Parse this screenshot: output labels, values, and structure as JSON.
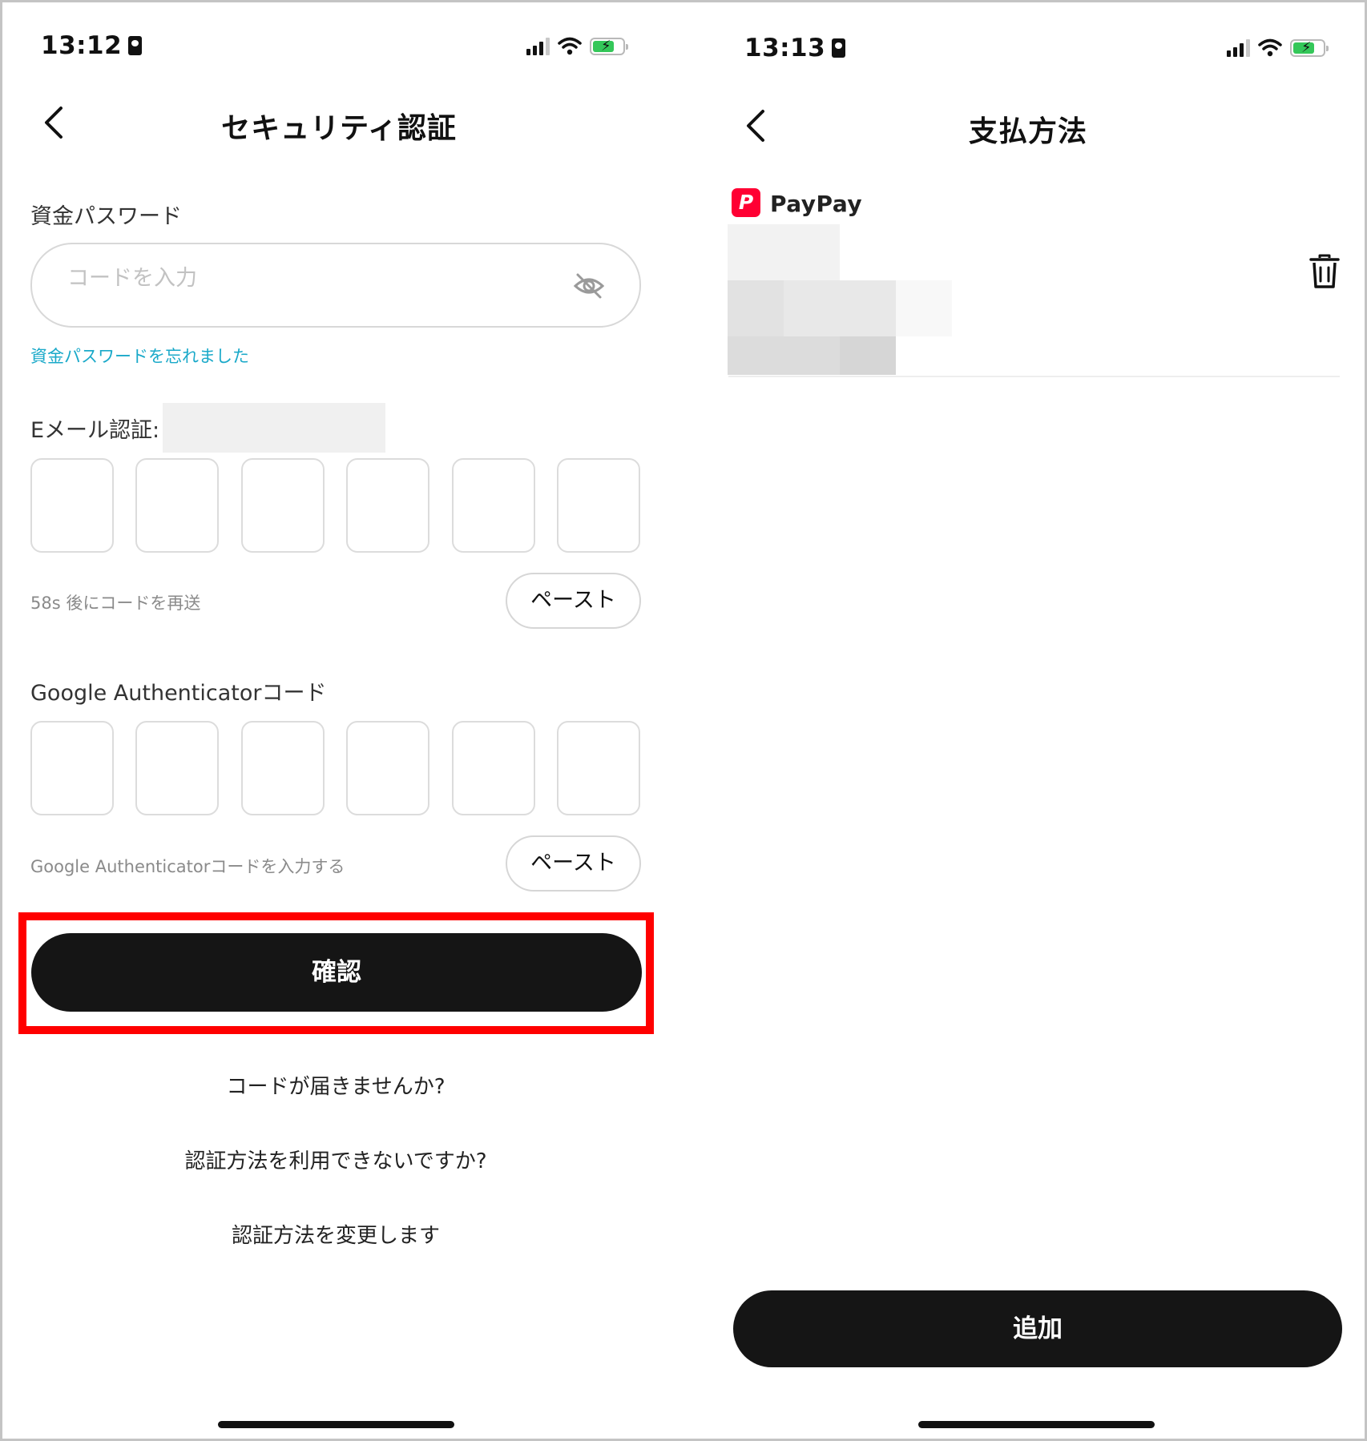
{
  "left": {
    "status": {
      "time": "13:12"
    },
    "nav": {
      "title": "セキュリティ認証"
    },
    "password": {
      "label": "資金パスワード",
      "placeholder": "コードを入力",
      "forgot": "資金パスワードを忘れました"
    },
    "email": {
      "label": "Eメール認証:",
      "resend": "58s 後にコードを再送",
      "paste": "ペースト"
    },
    "google": {
      "label": "Google Authenticatorコード",
      "hint": "Google Authenticatorコードを入力する",
      "paste": "ペースト"
    },
    "confirm": "確認",
    "links": {
      "no_code": "コードが届きませんか?",
      "cant_use": "認証方法を利用できないですか?",
      "change": "認証方法を変更します"
    }
  },
  "right": {
    "status": {
      "time": "13:13"
    },
    "nav": {
      "title": "支払方法"
    },
    "payment": {
      "logo_letter": "P",
      "name": "PayPay"
    },
    "add": "追加"
  },
  "colors": {
    "link": "#1aa9c9",
    "primary_button": "#151515",
    "highlight": "#ff0000",
    "paypay_red": "#ff0033",
    "battery": "#34c759"
  },
  "icons": [
    "sim-card-icon",
    "cellular-signal-icon",
    "wifi-icon",
    "battery-charging-icon",
    "back-chevron-icon",
    "eye-off-icon",
    "trash-icon"
  ]
}
